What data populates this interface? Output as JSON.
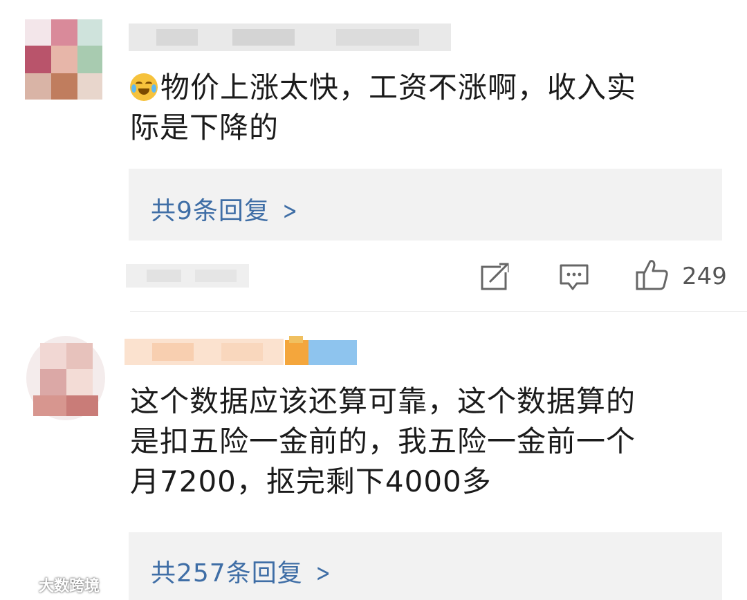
{
  "comments": [
    {
      "text": "物价上涨太快，工资不涨啊，收入实际是下降的",
      "text_line1": "物价上涨太快，工资不涨啊，收入实",
      "text_line2": "际是下降的",
      "emoji": "laugh-cry-emoji",
      "replies_label": "共9条回复",
      "likes": "249"
    },
    {
      "text": "这个数据应该还算可靠，这个数据算的是扣五险一金前的，我五险一金前一个月7200，抠完剩下4000多",
      "text_line1": "这个数据应该还算可靠，这个数据算的",
      "text_line2": "是扣五险一金前的，我五险一金前一个",
      "text_line3": "月7200，抠完剩下4000多",
      "replies_label": "共257条回复"
    }
  ],
  "icons": {
    "share": "share-icon",
    "comment": "comment-icon",
    "like": "thumbs-up-icon",
    "chevron": "chevron-right-icon"
  },
  "watermark": "大数跨境",
  "colors": {
    "reply_link": "#3f6ea6",
    "reply_bg": "#f2f2f2",
    "text": "#1b1b1b"
  }
}
